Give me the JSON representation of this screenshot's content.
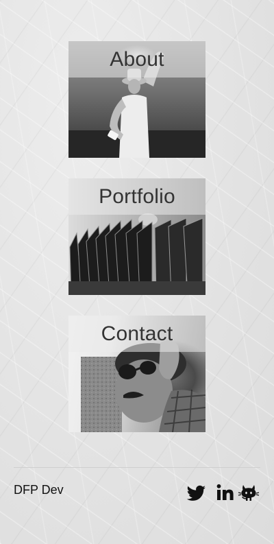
{
  "nav": {
    "tiles": [
      {
        "label": "About"
      },
      {
        "label": "Portfolio"
      },
      {
        "label": "Contact"
      }
    ]
  },
  "footer": {
    "brand": "DFP Dev",
    "social": [
      {
        "icon": "twitter-icon"
      },
      {
        "icon": "linkedin-icon"
      },
      {
        "icon": "github-icon"
      }
    ]
  },
  "colors": {
    "label_text": "#333333",
    "brand_text": "#111111",
    "icon": "#111111"
  }
}
